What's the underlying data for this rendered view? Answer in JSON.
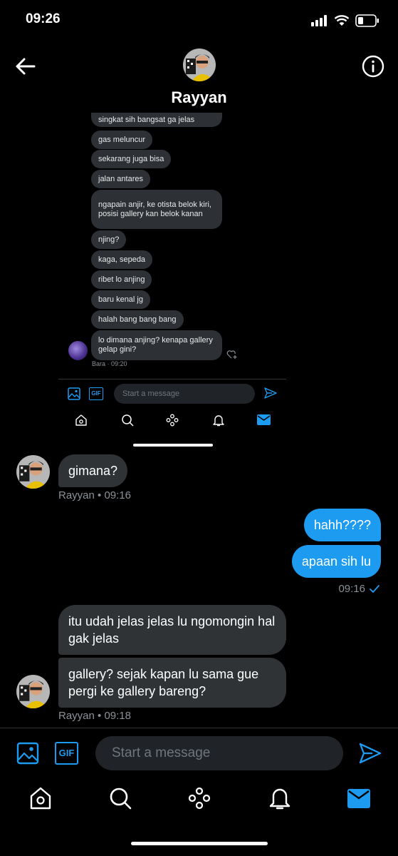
{
  "status_bar": {
    "time": "09:26"
  },
  "header": {
    "contact_name": "Rayyan"
  },
  "embedded_screenshot": {
    "messages": [
      "singkat sih bangsat ga jelas",
      "gas meluncur",
      "sekarang juga bisa",
      "jalan antares",
      "ngapain anjir, ke otista belok kiri, posisi gallery kan belok kanan",
      "njing?",
      "kaga, sepeda",
      "ribet lo anjing",
      "baru kenal jg",
      "halah bang bang bang",
      "lo dimana anjing? kenapa gallery gelap gini?"
    ],
    "meta": "Bara · 09:20",
    "composer_placeholder": "Start a message",
    "gif_label": "GIF"
  },
  "conversation": {
    "msg1": "gimana?",
    "meta1": "Rayyan  • 09:16",
    "out1": "hahh????",
    "out2": "apaan sih lu",
    "out_meta": "09:16",
    "msg2": "itu udah jelas jelas lu ngomongin hal gak jelas",
    "msg3": "gallery? sejak kapan lu sama gue pergi ke gallery bareng?",
    "meta2": "Rayyan  • 09:18"
  },
  "composer": {
    "placeholder": "Start a message",
    "gif_label": "GIF"
  },
  "icons": {
    "back": "arrow-left-icon",
    "info": "info-icon",
    "image": "image-icon",
    "gif": "gif-icon",
    "send": "send-icon",
    "home": "home-icon",
    "search": "search-icon",
    "spaces": "spaces-icon",
    "notifications": "bell-icon",
    "messages": "mail-icon"
  },
  "colors": {
    "accent": "#1d9bf0",
    "background": "#000000",
    "incoming_bubble": "#2f3336",
    "muted_text": "#8b9197"
  }
}
